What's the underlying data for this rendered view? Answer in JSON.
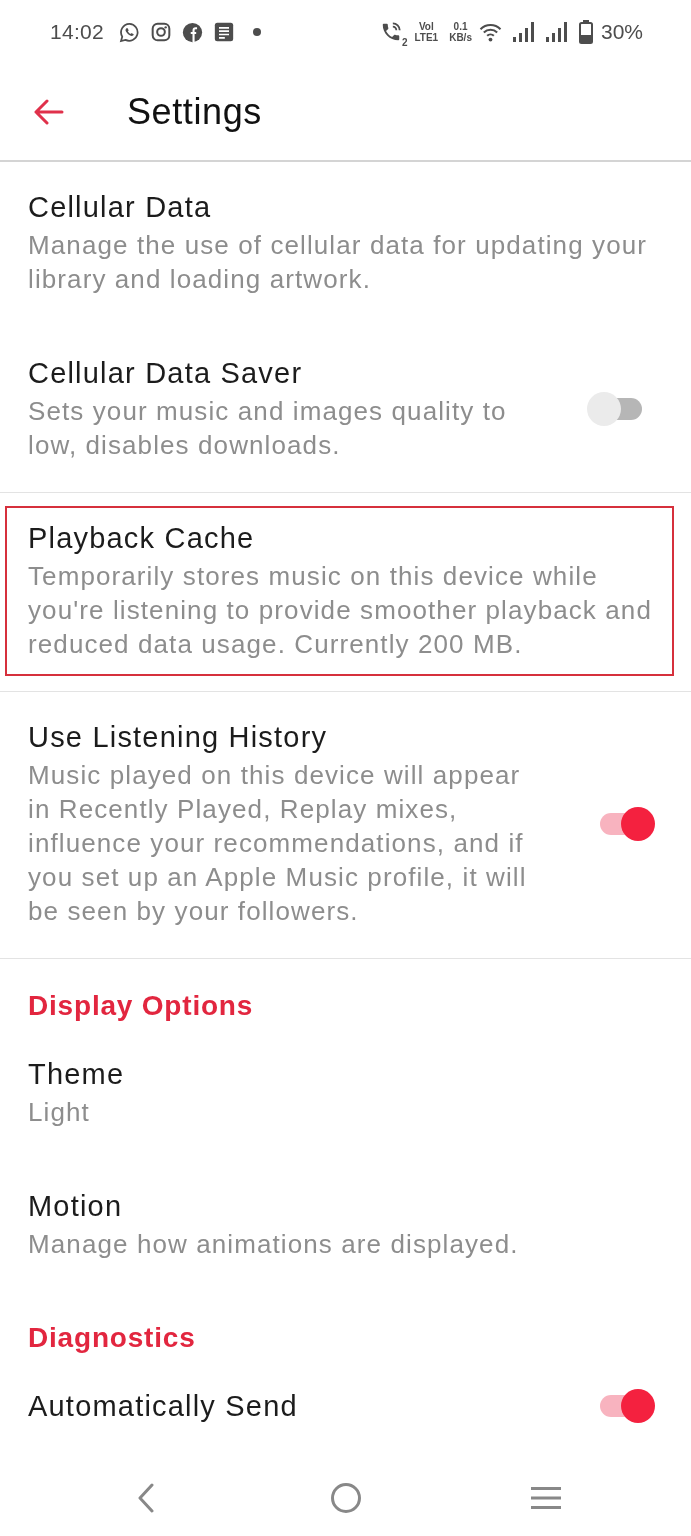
{
  "status_bar": {
    "time": "14:02",
    "sim_slot": "2",
    "network_top": "Vol",
    "network_bottom": "LTE1",
    "speed": "0.1",
    "speed_unit": "KB/s",
    "battery": "30%"
  },
  "header": {
    "title": "Settings"
  },
  "sections": [
    {
      "divider": true,
      "items": [
        {
          "kind": "plain",
          "title": "Cellular Data",
          "description": "Manage the use of cellular data for updating your library and loading artwork.",
          "highlighted": false
        },
        {
          "kind": "toggle",
          "title": "Cellular Data Saver",
          "description": "Sets your music and images quality to low, disables downloads.",
          "on": false,
          "highlighted": false
        }
      ]
    },
    {
      "divider": true,
      "items": [
        {
          "kind": "plain",
          "title": "Playback Cache",
          "description": "Temporarily stores music on this device while you're listening to provide smoother playback and reduced data usage. Currently 200 MB.",
          "highlighted": true
        }
      ]
    },
    {
      "divider": true,
      "items": [
        {
          "kind": "toggle",
          "title": "Use Listening History",
          "description": "Music played on this device will appear in Recently Played, Replay mixes, influence your recommendations, and if you set up an Apple Music profile, it will be seen by your followers.",
          "on": true,
          "highlighted": false
        }
      ]
    },
    {
      "heading": "Display Options",
      "divider": false,
      "items": [
        {
          "kind": "plain",
          "title": "Theme",
          "value": "Light",
          "highlighted": false
        },
        {
          "kind": "plain",
          "title": "Motion",
          "description": "Manage how animations are displayed.",
          "highlighted": false
        }
      ]
    },
    {
      "heading": "Diagnostics",
      "divider": false,
      "items": [
        {
          "kind": "toggle",
          "title": "Automatically Send",
          "on": true,
          "highlighted": false
        }
      ]
    }
  ]
}
